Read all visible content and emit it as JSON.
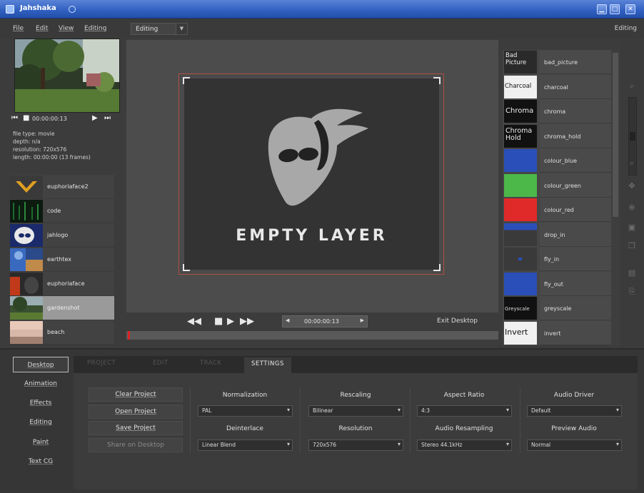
{
  "window": {
    "title": "Jahshaka"
  },
  "menubar": {
    "items": [
      "File",
      "Edit",
      "View",
      "Editing"
    ],
    "mode_value": "Editing",
    "mode_right": "Editing"
  },
  "preview": {
    "timecode": "00:00:00:13",
    "info_lines": [
      "file type: movie",
      "depth: n/a",
      "resolution: 720x576",
      "length: 00:00:00 (13 frames)"
    ]
  },
  "assets": [
    {
      "name": "euphoriaface2"
    },
    {
      "name": "code"
    },
    {
      "name": "jahlogo"
    },
    {
      "name": "earthtex"
    },
    {
      "name": "euphoriaface"
    },
    {
      "name": "gardenshot"
    },
    {
      "name": "beach"
    }
  ],
  "canvas": {
    "layer_label": "EMPTY LAYER"
  },
  "transport": {
    "time": "00:00:00:13",
    "exit_label": "Exit Desktop"
  },
  "effects": [
    {
      "thumb": "Bad Picture",
      "name": "bad_picture"
    },
    {
      "thumb": "Charcoal",
      "name": "charcoal"
    },
    {
      "thumb": "Chroma",
      "name": "chroma"
    },
    {
      "thumb": "Chroma Hold",
      "name": "chroma_hold"
    },
    {
      "thumb": "",
      "name": "colour_blue"
    },
    {
      "thumb": "",
      "name": "colour_green"
    },
    {
      "thumb": "",
      "name": "colour_red"
    },
    {
      "thumb": "",
      "name": "drop_in"
    },
    {
      "thumb": "",
      "name": "fly_in"
    },
    {
      "thumb": "",
      "name": "fly_out"
    },
    {
      "thumb": "Greyscale",
      "name": "greyscale"
    },
    {
      "thumb": "Invert",
      "name": "invert"
    }
  ],
  "side_buttons": [
    "Desktop",
    "Animation",
    "Effects",
    "Editing",
    "Paint",
    "Text CG"
  ],
  "tabs": [
    "PROJECT",
    "EDIT",
    "TRACK",
    "SETTINGS"
  ],
  "project_buttons": [
    "Clear Project",
    "Open Project",
    "Save Project",
    "Share on Desktop"
  ],
  "settings": {
    "normalization": {
      "label": "Normalization",
      "value": "PAL"
    },
    "deinterlace": {
      "label": "Deinterlace",
      "value": "Linear Blend"
    },
    "rescaling": {
      "label": "Rescaling",
      "value": "Bilinear"
    },
    "resolution": {
      "label": "Resolution",
      "value": "720x576"
    },
    "aspect_ratio": {
      "label": "Aspect Ratio",
      "value": "4:3"
    },
    "audio_resampling": {
      "label": "Audio Resampling",
      "value": "Stereo 44.1kHz"
    },
    "audio_driver": {
      "label": "Audio Driver",
      "value": "Default"
    },
    "preview_audio": {
      "label": "Preview Audio",
      "value": "Normal"
    }
  },
  "colors": {
    "titlebar": "#2f5fc0",
    "background": "#3c3c3c",
    "layer_border": "#b05040",
    "alien_head": "#a8a8a8",
    "effect_blue": "#2a4fb8",
    "effect_green": "#4cb84a",
    "effect_red": "#e02a2a"
  }
}
